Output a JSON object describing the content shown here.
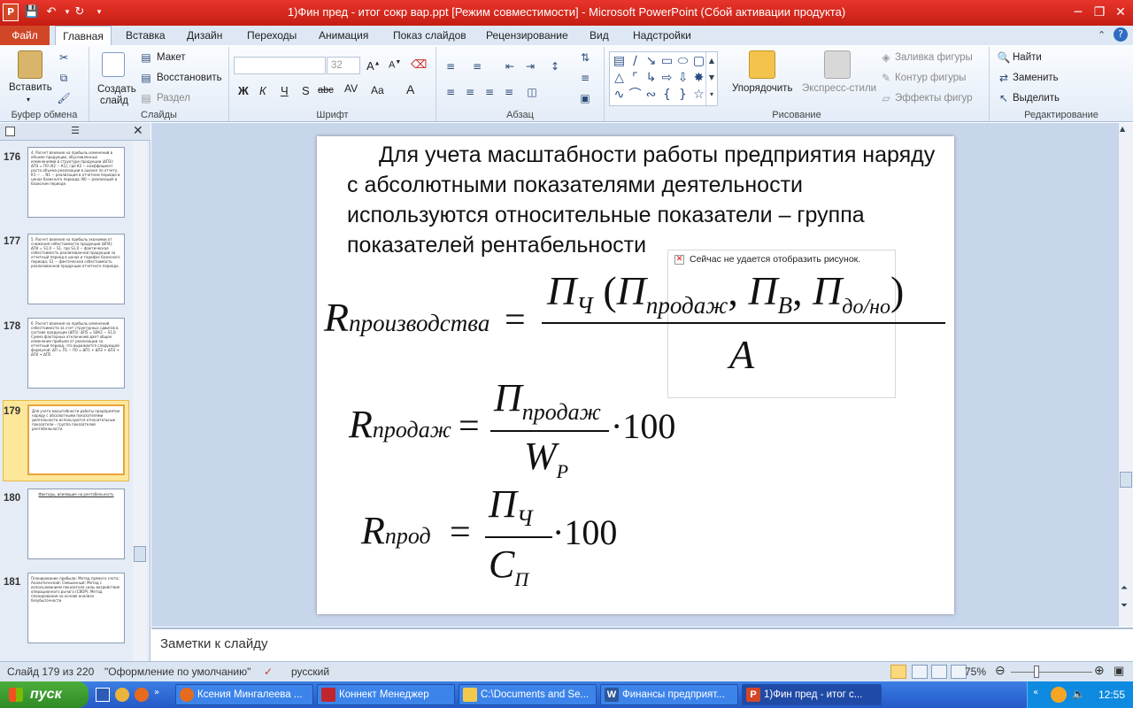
{
  "window": {
    "title": "1)Фин пред - итог сокр вар.ppt [Режим совместимости] - Microsoft PowerPoint (Сбой активации продукта)"
  },
  "ribbon_tabs": {
    "file": "Файл",
    "items": [
      "Главная",
      "Вставка",
      "Дизайн",
      "Переходы",
      "Анимация",
      "Показ слайдов",
      "Рецензирование",
      "Вид",
      "Надстройки"
    ]
  },
  "ribbon": {
    "clipboard": {
      "paste": "Вставить",
      "label": "Буфер обмена"
    },
    "slides": {
      "new_slide_1": "Создать",
      "new_slide_2": "слайд",
      "layout": "Макет",
      "reset": "Восстановить",
      "section": "Раздел",
      "label": "Слайды"
    },
    "font": {
      "size": "32",
      "label": "Шрифт",
      "bold": "Ж",
      "italic": "К",
      "underline": "Ч",
      "strike": "S",
      "abc": "abc"
    },
    "paragraph": {
      "label": "Абзац"
    },
    "drawing": {
      "arrange": "Упорядочить",
      "quick_styles": "Экспресс-стили",
      "fill": "Заливка фигуры",
      "outline": "Контур фигуры",
      "effects": "Эффекты фигур",
      "label": "Рисование"
    },
    "editing": {
      "find": "Найти",
      "replace": "Заменить",
      "select": "Выделить",
      "label": "Редактирование"
    }
  },
  "thumbnails": [
    {
      "num": "176",
      "text": "4. Расчет влияния на прибыль изменений в объеме продукции, обусловленных изменениями в структуре продукции (ΔП3): ΔП3 = П0 (К2 − К1), где К2 − коэффициент роста объема реализации в оценке по отчету, К1 − ... N1 − реализация в отчетном периоде в ценах базисного периода; N0 − реализация в базисном периоде."
    },
    {
      "num": "177",
      "text": "5. Расчет влияния на прибыль экономии от снижения себестоимости продукции (ΔП4): ΔП4 = S1,0 − S1, где S1,0 − фактическая себестоимость реализованной продукции за отчетный период в ценах и тарифах базисного периода; S1 − фактическая себестоимость реализованной продукции отчетного периода."
    },
    {
      "num": "178",
      "text": "6. Расчет влияния на прибыль изменений себестоимости за счет структурных сдвигов в составе продукции (ΔП5): ΔП5 = S0К2 − S1,0. Сумма факторных отклонений дает общее изменение прибыли от реализации за отчетный период, что выражается следующей формулой: ΔП = П1 − П0 = ΔП1 + ΔП2 + ΔП3 + ΔП4 + ΔП5"
    },
    {
      "num": "179",
      "text": "Для учета масштабности работы предприятия наряду с абсолютными показателями деятельности используются относительные показатели – группа показателей рентабельности"
    },
    {
      "num": "180",
      "text": "Факторы, влияющие на рентабельность"
    },
    {
      "num": "181",
      "text": "Планирование прибыли: Метод прямого счета; Аналитический; Смешанный; Метод с использованием показателя силы воздействия операционного рычага (СВОР); Метод планирования на основе анализа безубыточности"
    }
  ],
  "slide": {
    "body_text": "Для учета масштабности работы предприятия наряду с абсолютными показателями деятельности используются относительные показатели – группа показателей рентабельности",
    "picture_error": "Сейчас не удается отобразить рисунок.",
    "formula1": {
      "lhs": "R",
      "lhs_sub": "производства",
      "num_main": "П",
      "num_sub": "Ч",
      "num_arg1": "П",
      "num_arg1_sub": "продаж",
      "num_arg2": "П",
      "num_arg2_sub": "В",
      "num_arg3": "П",
      "num_arg3_sub": "до/но",
      "den": "А"
    },
    "formula2": {
      "lhs": "R",
      "lhs_sub": "продаж",
      "num": "П",
      "num_sub": "продаж",
      "den": "W",
      "den_sub": "Р",
      "mult": "·100"
    },
    "formula3": {
      "lhs": "R",
      "lhs_sub": "прод",
      "num": "П",
      "num_sub": "Ч",
      "den": "С",
      "den_sub": "П",
      "mult": "·100"
    }
  },
  "notes_placeholder": "Заметки к слайду",
  "status": {
    "slide_info": "Слайд 179 из 220",
    "theme": "\"Оформление по умолчанию\"",
    "language": "русский",
    "zoom": "75%"
  },
  "taskbar": {
    "start": "пуск",
    "buttons": [
      "Ксения Мингалеева ...",
      "Коннект Менеджер",
      "C:\\Documents and Se...",
      "Финансы предприят...",
      "1)Фин пред - итог с..."
    ],
    "lang": "EN",
    "clock": "12:55"
  }
}
